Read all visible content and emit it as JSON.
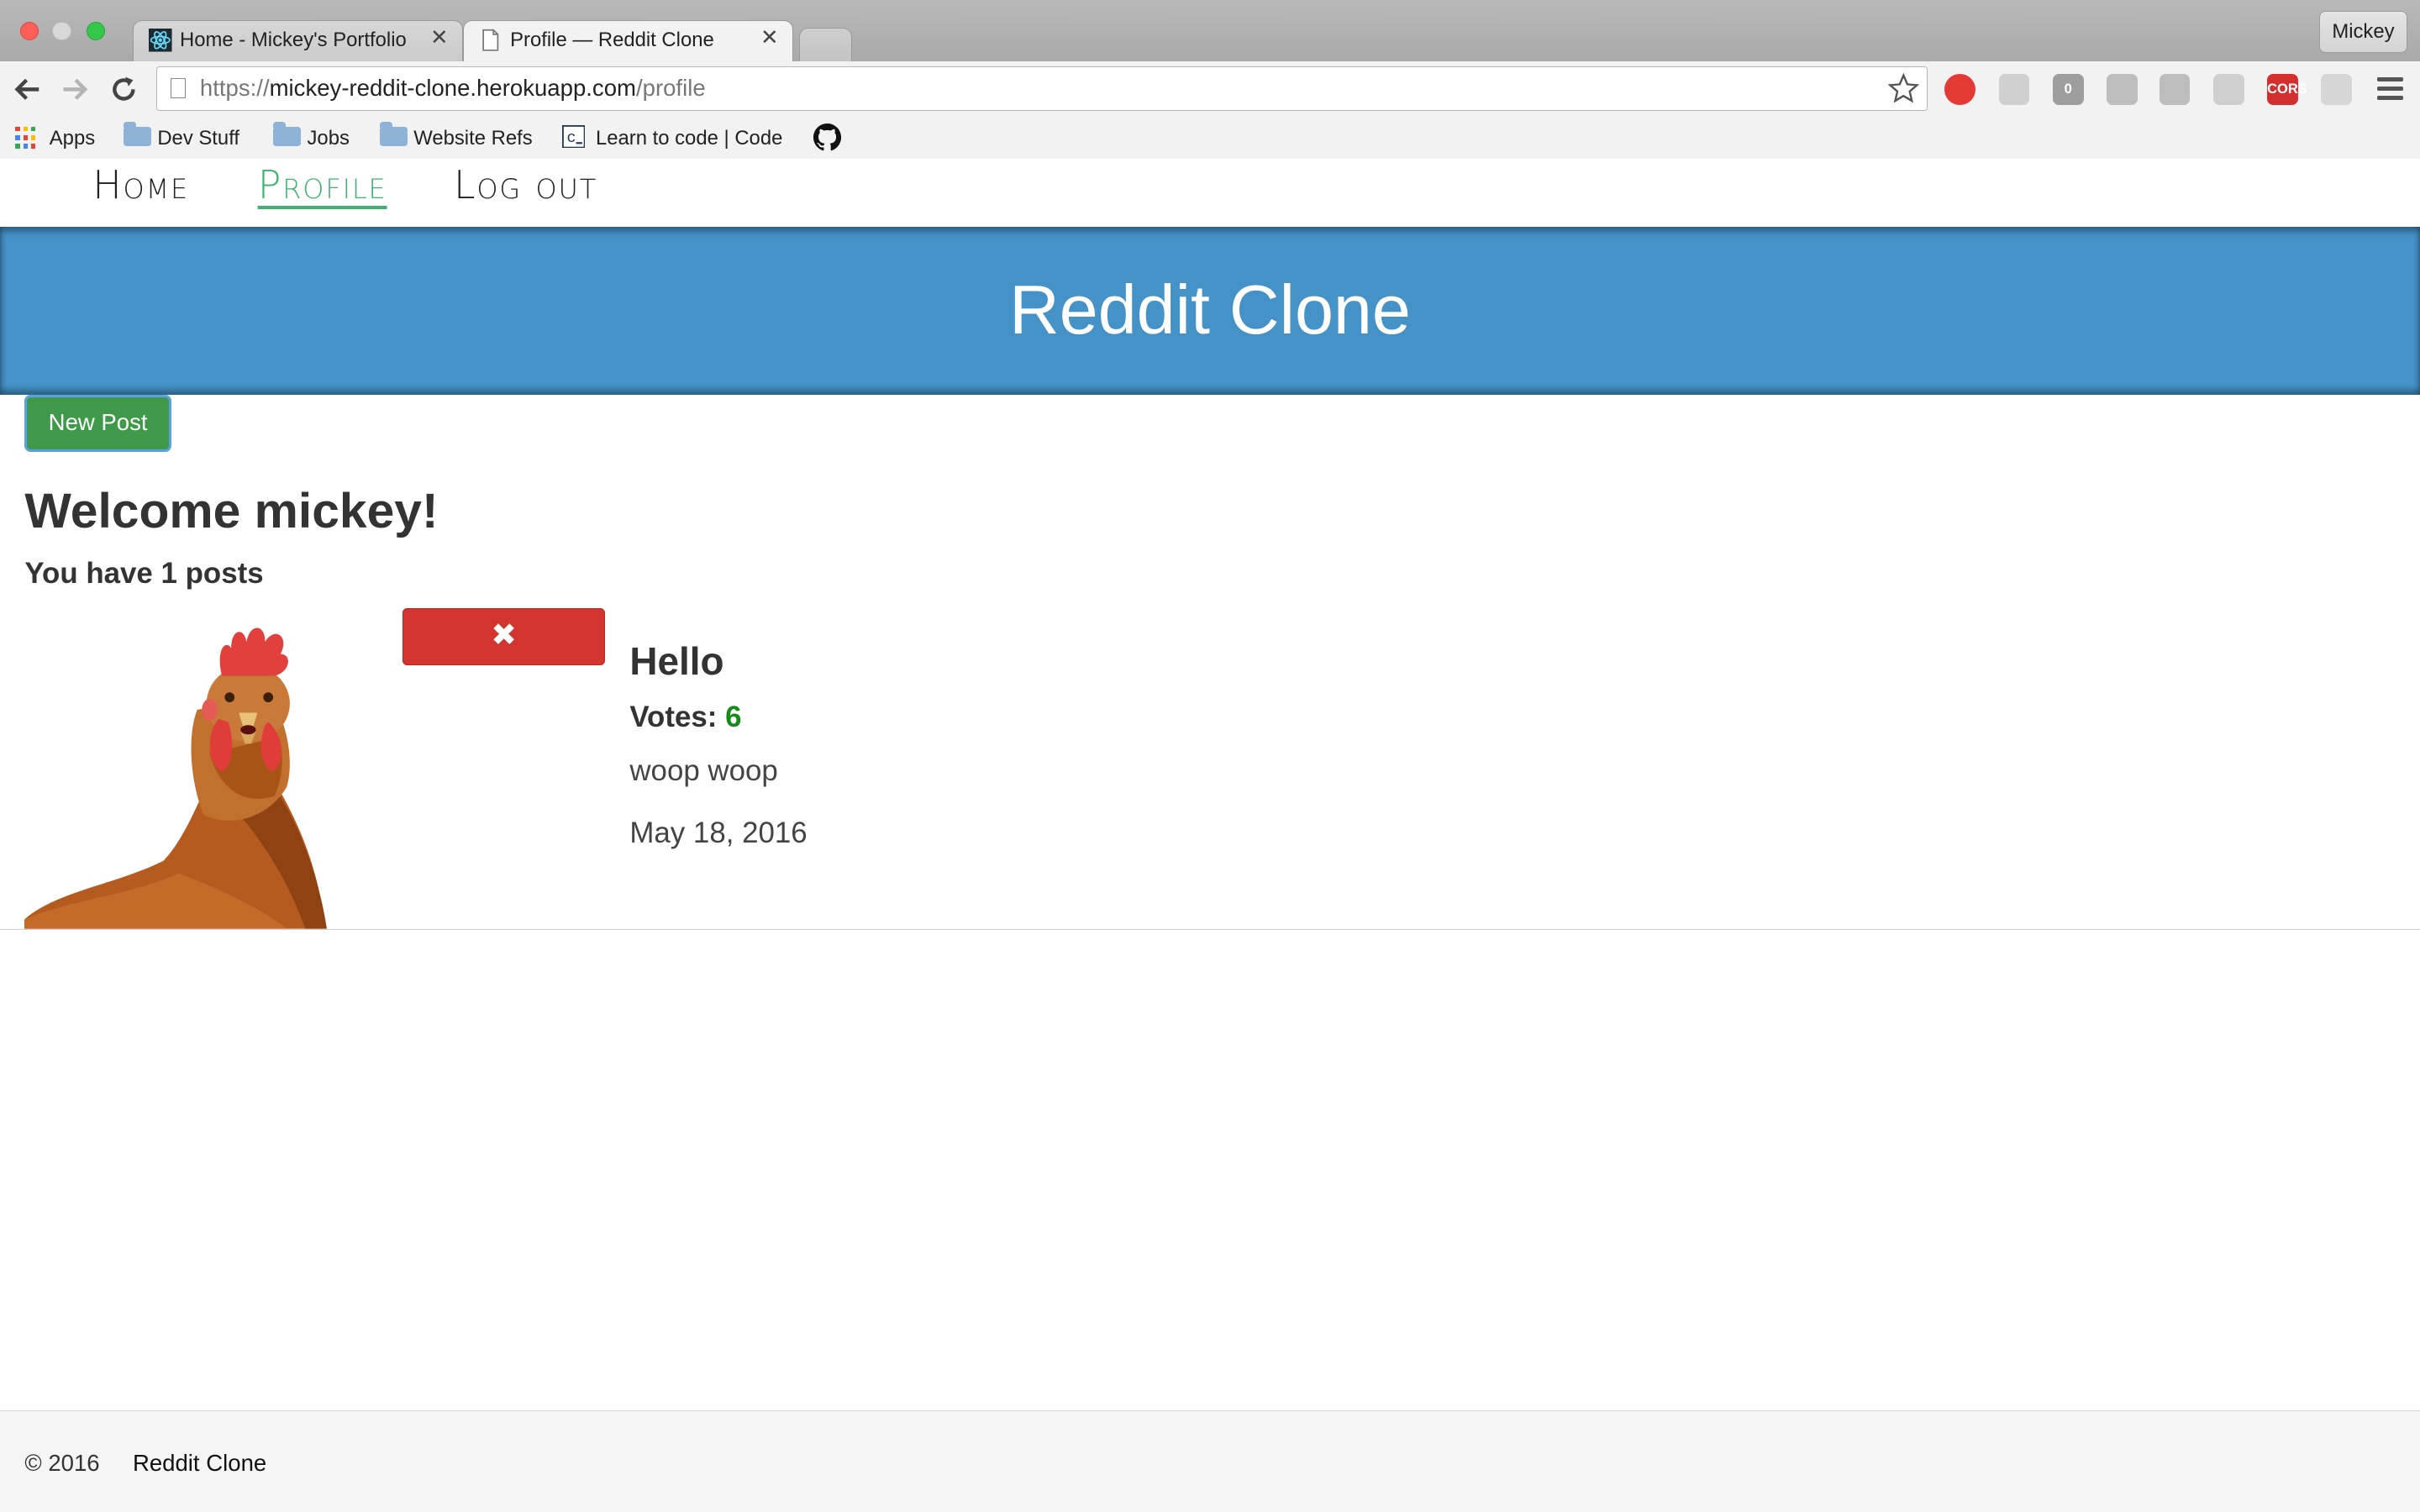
{
  "browser": {
    "tabs": [
      {
        "title": "Home - Mickey's Portfolio",
        "favicon": "react-atom-icon",
        "active": false
      },
      {
        "title": "Profile — Reddit Clone",
        "favicon": "page-icon",
        "active": true
      }
    ],
    "close_glyph": "✕",
    "profile_label": "Mickey",
    "url": {
      "scheme": "https://",
      "host": "mickey-reddit-clone.herokuapp.com",
      "path": "/profile"
    },
    "extensions": [
      {
        "name": "adblock-icon",
        "color": "#e53935",
        "label": ""
      },
      {
        "name": "ghostery-icon",
        "color": "#d0d0d0",
        "label": ""
      },
      {
        "name": "zero-ext-icon",
        "color": "#9e9e9e",
        "label": "0"
      },
      {
        "name": "react-devtools-icon",
        "color": "#bdbdbd",
        "label": ""
      },
      {
        "name": "wappalyzer-icon",
        "color": "#bdbdbd",
        "label": ""
      },
      {
        "name": "feather-icon",
        "color": "#cfcfcf",
        "label": ""
      },
      {
        "name": "cors-icon",
        "color": "#d32f2f",
        "label": "CORS"
      },
      {
        "name": "gray-ext-icon",
        "color": "#d6d6d6",
        "label": ""
      }
    ],
    "bookmarks": [
      {
        "label": "Apps",
        "icon": "apps-grid-icon"
      },
      {
        "label": "Dev Stuff",
        "icon": "folder-icon"
      },
      {
        "label": "Jobs",
        "icon": "folder-icon"
      },
      {
        "label": "Website Refs",
        "icon": "folder-icon"
      },
      {
        "label": "Learn to code | Code",
        "icon": "codecademy-icon"
      },
      {
        "label": "",
        "icon": "github-icon"
      }
    ]
  },
  "site": {
    "nav": [
      "Home",
      "Profile",
      "Log out"
    ],
    "active_nav": "Profile",
    "accent_color": "#3cb371",
    "banner_title": "Reddit Clone",
    "banner_color": "#4592c8",
    "new_post_label": "New Post",
    "welcome": "Welcome mickey!",
    "post_count": "You have 1 posts",
    "posts": [
      {
        "title": "Hello",
        "votes_label": "Votes:",
        "votes": "6",
        "body": "woop woop",
        "date": "May 18, 2016",
        "image": "chicken-photo",
        "delete_glyph": "✖"
      }
    ],
    "footer": {
      "copyright": "© 2016",
      "name": "Reddit Clone"
    }
  }
}
